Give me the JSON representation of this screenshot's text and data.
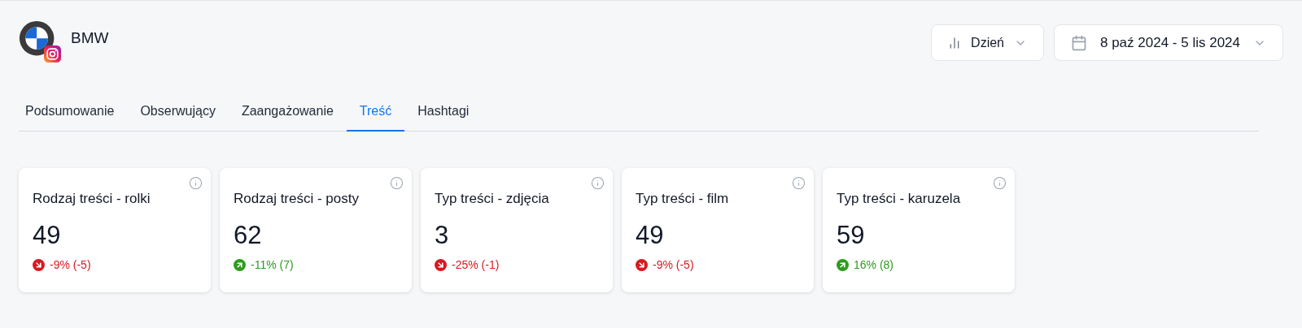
{
  "profile": {
    "name": "BMW"
  },
  "controls": {
    "interval": "Dzień",
    "date_range": "8 paź 2024 - 5 lis 2024"
  },
  "tabs": [
    {
      "label": "Podsumowanie",
      "selected": false
    },
    {
      "label": "Obserwujący",
      "selected": false
    },
    {
      "label": "Zaangażowanie",
      "selected": false
    },
    {
      "label": "Treść",
      "selected": true
    },
    {
      "label": "Hashtagi",
      "selected": false
    }
  ],
  "cards": [
    {
      "title": "Rodzaj treści - rolki",
      "value": "49",
      "kind": "down",
      "change": "-9% (-5)"
    },
    {
      "title": "Rodzaj treści - posty",
      "value": "62",
      "kind": "up",
      "change": "-11% (7)"
    },
    {
      "title": "Typ treści - zdjęcia",
      "value": "3",
      "kind": "down",
      "change": "-25% (-1)"
    },
    {
      "title": "Typ treści - film",
      "value": "49",
      "kind": "down",
      "change": "-9% (-5)"
    },
    {
      "title": "Typ treści - karuzela",
      "value": "59",
      "kind": "up",
      "change": "16% (8)"
    }
  ]
}
